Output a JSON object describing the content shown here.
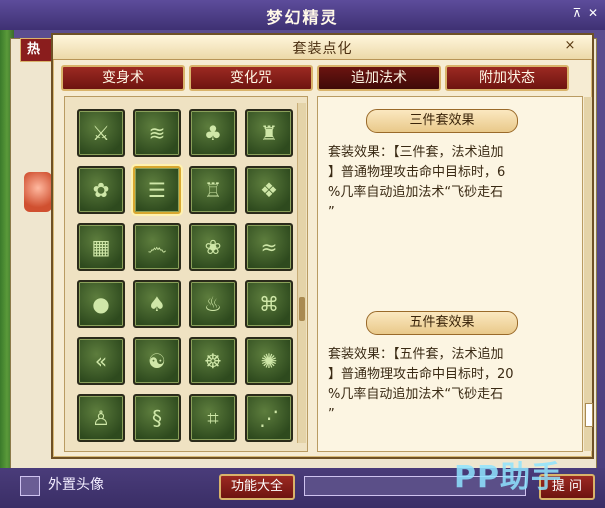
{
  "outer": {
    "title": "梦幻精灵",
    "hot_tab": "热",
    "bottom_checkbox_label": "外置头像",
    "function_button": "功能大全",
    "ask_button": "提 问",
    "watermark": "PP助手"
  },
  "dialog": {
    "title": "套装点化",
    "close": "×",
    "tabs": [
      {
        "label": "变身术",
        "active": false
      },
      {
        "label": "变化咒",
        "active": false
      },
      {
        "label": "追加法术",
        "active": true
      },
      {
        "label": "附加状态",
        "active": false
      }
    ],
    "skills": [
      {
        "icon": "weapon-bundle-icon",
        "glyph": "⚔"
      },
      {
        "icon": "slash-lines-icon",
        "glyph": "≋"
      },
      {
        "icon": "mushroom-figure-icon",
        "glyph": "♣"
      },
      {
        "icon": "demon-face-icon",
        "glyph": "♜"
      },
      {
        "icon": "gear-circle-icon",
        "glyph": "✿"
      },
      {
        "icon": "cloud-lines-icon",
        "glyph": "☰",
        "selected": true
      },
      {
        "icon": "castle-icon",
        "glyph": "♖"
      },
      {
        "icon": "scroll-banner-icon",
        "glyph": "❖"
      },
      {
        "icon": "door-panel-icon",
        "glyph": "▦"
      },
      {
        "icon": "spiral-cloud-icon",
        "glyph": "෴"
      },
      {
        "icon": "flower-icon",
        "glyph": "❀"
      },
      {
        "icon": "wave-scroll-icon",
        "glyph": "≈"
      },
      {
        "icon": "boulders-icon",
        "glyph": "●"
      },
      {
        "icon": "tree-icon",
        "glyph": "♠"
      },
      {
        "icon": "flame-icon",
        "glyph": "♨"
      },
      {
        "icon": "bracket-seal-icon",
        "glyph": "⌘"
      },
      {
        "icon": "chevrons-icon",
        "glyph": "«"
      },
      {
        "icon": "yin-yang-icon",
        "glyph": "☯"
      },
      {
        "icon": "monster-icon",
        "glyph": "☸"
      },
      {
        "icon": "splash-icon",
        "glyph": "✺"
      },
      {
        "icon": "armor-figure-icon",
        "glyph": "♙"
      },
      {
        "icon": "dragon-icon",
        "glyph": "§"
      },
      {
        "icon": "rune-grid-icon",
        "glyph": "⌗"
      },
      {
        "icon": "claw-marks-icon",
        "glyph": "⋰"
      }
    ],
    "effects": [
      {
        "header": "三件套效果",
        "lines": [
          "套装效果：【三件套，法术追加",
          "】普通物理攻击命中目标时，6",
          "%几率自动追加法术“飞砂走石",
          "”"
        ]
      },
      {
        "header": "五件套效果",
        "lines": [
          "套装效果：【五件套，法术追加",
          "】普通物理攻击命中目标时，20",
          "%几率自动追加法术“飞砂走石",
          "”"
        ]
      }
    ]
  }
}
